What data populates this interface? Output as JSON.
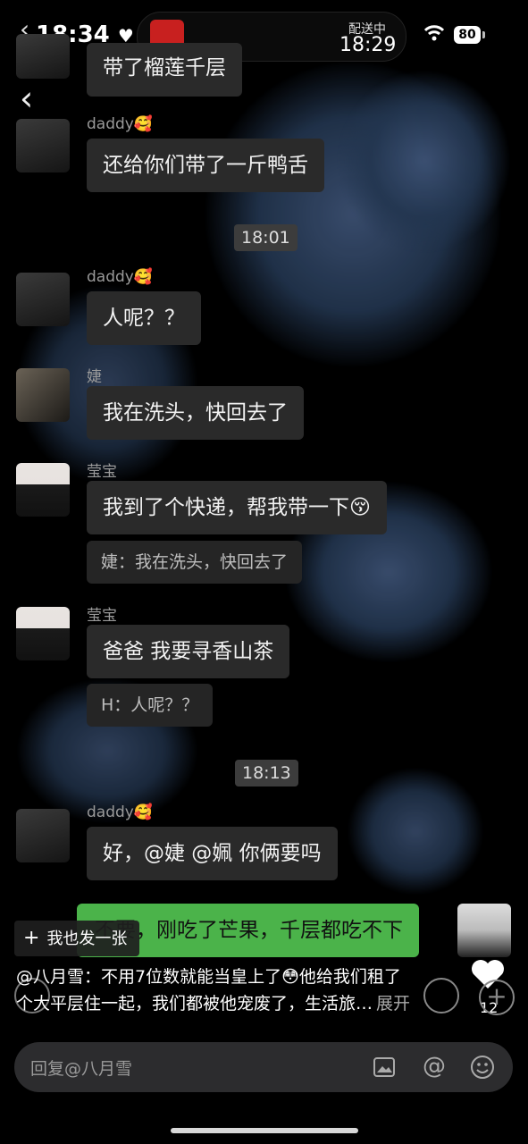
{
  "status_bar": {
    "time": "18:34",
    "heart": "♥",
    "delivery_label": "配送中",
    "delivery_time": "18:29",
    "battery": "80",
    "icons": [
      "back-chevron-icon",
      "scooter-icon",
      "wifi-icon",
      "battery-icon"
    ]
  },
  "chat": {
    "top_partial": "带了榴莲千层",
    "messages": [
      {
        "sender": "daddy🥰",
        "text": "还给你们带了一斤鸭舌"
      },
      {
        "timestamp": "18:01"
      },
      {
        "sender": "daddy🥰",
        "text": "人呢？？"
      },
      {
        "sender": "婕",
        "text": "我在洗头，快回去了"
      },
      {
        "sender": "莹宝",
        "text": "我到了个快递，帮我带一下😚",
        "quote": "婕：我在洗头，快回去了"
      },
      {
        "sender": "莹宝",
        "text": "爸爸 我要寻香山茶",
        "quote": "H：人呢？？"
      },
      {
        "timestamp": "18:13"
      },
      {
        "sender": "daddy🥰",
        "text": "好，@婕 @姵 你俩要吗"
      },
      {
        "sender": "me",
        "text": "不要，刚吃了芒果，千层都吃不下"
      }
    ]
  },
  "overlay": {
    "fab_plus": "+",
    "fab_label": "我也发一张",
    "caption_line1": "@八月雪：不用7位数就能当皇上了😳他给我们租了",
    "caption_line2": "个大平层住一起，我们都被他宠废了，生活旅…",
    "caption_more": "展开",
    "like_count": "12"
  },
  "input": {
    "placeholder": "回复@八月雪",
    "icons": [
      "image-icon",
      "at-icon",
      "emoji-icon"
    ]
  }
}
